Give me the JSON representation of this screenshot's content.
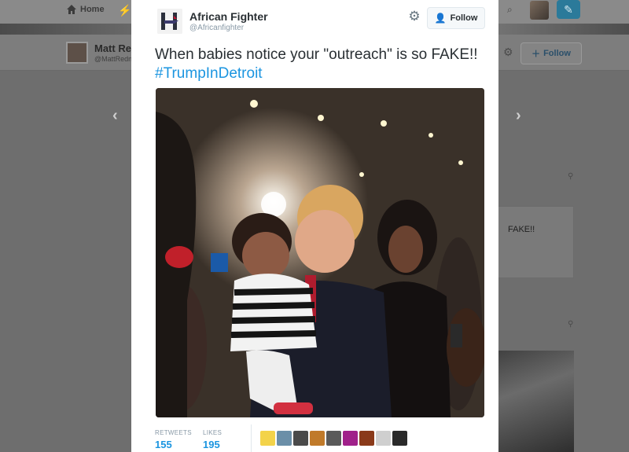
{
  "background": {
    "nav": {
      "home_label": "Home"
    },
    "profile": {
      "name": "Matt Re",
      "handle": "@MattRedn"
    },
    "follow_label": "Follow",
    "card_text": "FAKE!!"
  },
  "modal": {
    "author": "African Fighter",
    "handle": "@Africanfighter",
    "follow_label": "Follow",
    "tweet_text": "When babies notice your \"outreach\" is so FAKE!!",
    "hashtag": "#TrumpInDetroit",
    "stats": {
      "retweets_label": "RETWEETS",
      "retweets": "155",
      "likes_label": "LIKES",
      "likes": "195"
    },
    "likers": [
      {
        "name": "liker-1",
        "color": "#f3d34a"
      },
      {
        "name": "liker-2",
        "color": "#6b8fa8"
      },
      {
        "name": "liker-3",
        "color": "#4a4a4a"
      },
      {
        "name": "liker-4",
        "color": "#c07a2a"
      },
      {
        "name": "liker-5",
        "color": "#5a5a5a"
      },
      {
        "name": "liker-6",
        "color": "#a0208a"
      },
      {
        "name": "liker-7",
        "color": "#8a3a1a"
      },
      {
        "name": "liker-8",
        "color": "#cfcfcf"
      },
      {
        "name": "liker-9",
        "color": "#2a2a2a"
      }
    ]
  },
  "colors": {
    "link": "#1b95e0",
    "text": "#292f33",
    "muted": "#8899a6"
  }
}
